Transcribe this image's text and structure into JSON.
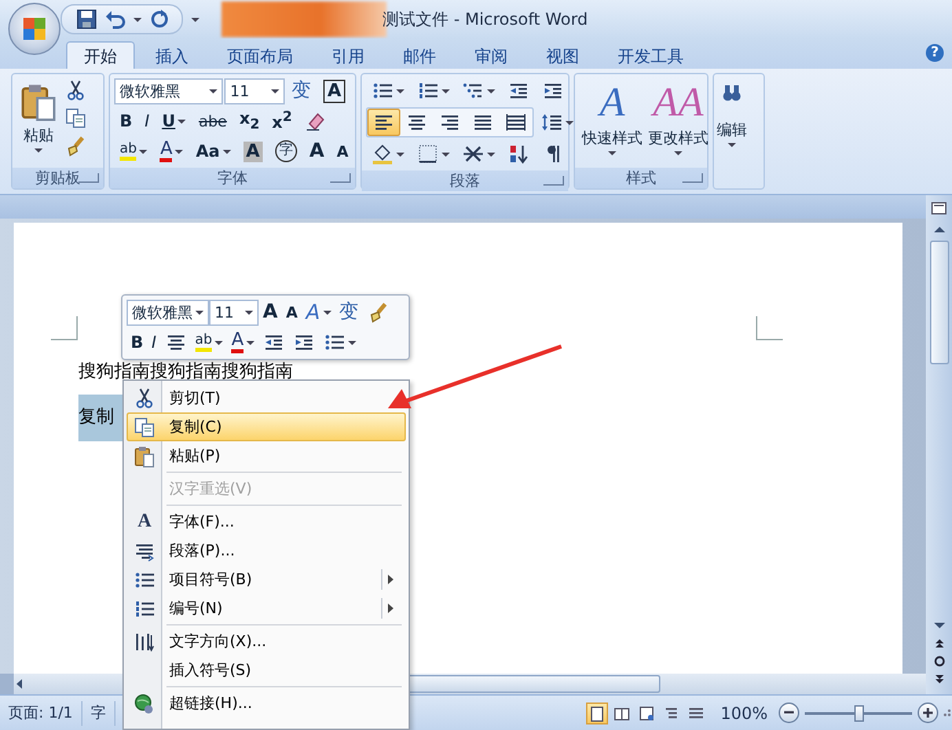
{
  "window": {
    "title": "测试文件 - Microsoft Word"
  },
  "tabs": [
    {
      "label": "开始",
      "selected": true
    },
    {
      "label": "插入",
      "selected": false
    },
    {
      "label": "页面布局",
      "selected": false
    },
    {
      "label": "引用",
      "selected": false
    },
    {
      "label": "邮件",
      "selected": false
    },
    {
      "label": "审阅",
      "selected": false
    },
    {
      "label": "视图",
      "selected": false
    },
    {
      "label": "开发工具",
      "selected": false
    }
  ],
  "help_icon": "?",
  "ribbon": {
    "clipboard": {
      "label": "剪贴板",
      "paste": "粘贴"
    },
    "font": {
      "label": "字体",
      "font_name": "微软雅黑",
      "font_size": "11",
      "row1": [
        {
          "kind": "phonetic",
          "text": "变"
        },
        {
          "kind": "border-char",
          "text": "A"
        }
      ],
      "row2": [
        {
          "kind": "bold",
          "text": "B"
        },
        {
          "kind": "italic",
          "text": "I"
        },
        {
          "kind": "underline",
          "text": "U"
        },
        {
          "kind": "strike",
          "text": "abe"
        },
        {
          "kind": "sub",
          "text": "x$_{2}$"
        },
        {
          "kind": "sup",
          "text": "x$^{2}$"
        },
        {
          "kind": "clear"
        }
      ],
      "row3": [
        {
          "kind": "highlight",
          "text": "ab"
        },
        {
          "kind": "color",
          "text": "A"
        },
        {
          "kind": "case",
          "text": "Aa"
        },
        {
          "kind": "shade",
          "text": "A"
        },
        {
          "kind": "enclose",
          "text": "字"
        },
        {
          "kind": "grow",
          "text": "A"
        },
        {
          "kind": "shrink",
          "text": "A"
        }
      ]
    },
    "paragraph": {
      "label": "段落",
      "row1": [
        {
          "kind": "bullets"
        },
        {
          "kind": "numbering"
        },
        {
          "kind": "multilevel"
        },
        {
          "kind": "outdent"
        },
        {
          "kind": "indent"
        }
      ],
      "align": [
        {
          "kind": "align-left",
          "selected": true
        },
        {
          "kind": "align-center",
          "selected": false
        },
        {
          "kind": "align-right",
          "selected": false
        },
        {
          "kind": "justify",
          "selected": false
        },
        {
          "kind": "distribute",
          "selected": false
        }
      ],
      "row2_extra": [
        {
          "kind": "line-spacing"
        }
      ],
      "row3": [
        {
          "kind": "shading"
        },
        {
          "kind": "borders"
        },
        {
          "kind": "asian"
        },
        {
          "kind": "sort"
        },
        {
          "kind": "marks"
        }
      ]
    },
    "styles": {
      "label": "样式",
      "buttons": [
        {
          "kind": "quick",
          "glyph": "A",
          "label": "快速样式"
        },
        {
          "kind": "change",
          "glyph": "AA",
          "label": "更改样式"
        }
      ]
    },
    "editing": {
      "label": "编辑"
    }
  },
  "document": {
    "lines": [
      {
        "text": "搜狗指南搜狗指南搜狗指南",
        "selected": false
      },
      {
        "text": "复制",
        "selected": true
      }
    ]
  },
  "mini_toolbar": {
    "font_name": "微软雅黑",
    "font_size": "11",
    "row1": [
      {
        "kind": "grow",
        "text": "A"
      },
      {
        "kind": "shrink",
        "text": "A"
      },
      {
        "kind": "style",
        "text": "A"
      },
      {
        "kind": "phonetic",
        "text": "变"
      },
      {
        "kind": "brush"
      }
    ],
    "row2": [
      {
        "kind": "bold",
        "text": "B"
      },
      {
        "kind": "italic",
        "text": "I"
      },
      {
        "kind": "align-center"
      },
      {
        "kind": "highlight",
        "text": "ab"
      },
      {
        "kind": "color",
        "text": "A"
      },
      {
        "kind": "outdent"
      },
      {
        "kind": "indent"
      },
      {
        "kind": "bullets"
      }
    ]
  },
  "context_menu": {
    "items": [
      {
        "label": "剪切(T)",
        "highlighted": false,
        "disabled": false,
        "submenu": false,
        "separator_after": false
      },
      {
        "label": "复制(C)",
        "highlighted": true,
        "disabled": false,
        "submenu": false,
        "separator_after": false
      },
      {
        "label": "粘贴(P)",
        "highlighted": false,
        "disabled": false,
        "submenu": false,
        "separator_after": true
      },
      {
        "label": "汉字重选(V)",
        "highlighted": false,
        "disabled": true,
        "submenu": false,
        "separator_after": true
      },
      {
        "label": "字体(F)...",
        "glyph": "A",
        "highlighted": false,
        "disabled": false,
        "submenu": false,
        "separator_after": false
      },
      {
        "label": "段落(P)...",
        "highlighted": false,
        "disabled": false,
        "submenu": false,
        "separator_after": false
      },
      {
        "label": "项目符号(B)",
        "highlighted": false,
        "disabled": false,
        "submenu": true,
        "separator_after": false
      },
      {
        "label": "编号(N)",
        "highlighted": false,
        "disabled": false,
        "submenu": true,
        "separator_after": true
      },
      {
        "label": "文字方向(X)...",
        "highlighted": false,
        "disabled": false,
        "submenu": false,
        "separator_after": false
      },
      {
        "label": "插入符号(S)",
        "highlighted": false,
        "disabled": false,
        "submenu": false,
        "separator_after": true
      },
      {
        "label": "超链接(H)...",
        "highlighted": false,
        "disabled": false,
        "submenu": false,
        "separator_after": false
      }
    ]
  },
  "status_bar": {
    "page": "页面: 1/1",
    "words": "字",
    "views": [
      {
        "selected": true
      },
      {
        "selected": false
      },
      {
        "selected": false
      },
      {
        "selected": false
      },
      {
        "selected": false
      }
    ],
    "zoom": "100%",
    "zoom_slider": {
      "level": 0.5
    }
  }
}
